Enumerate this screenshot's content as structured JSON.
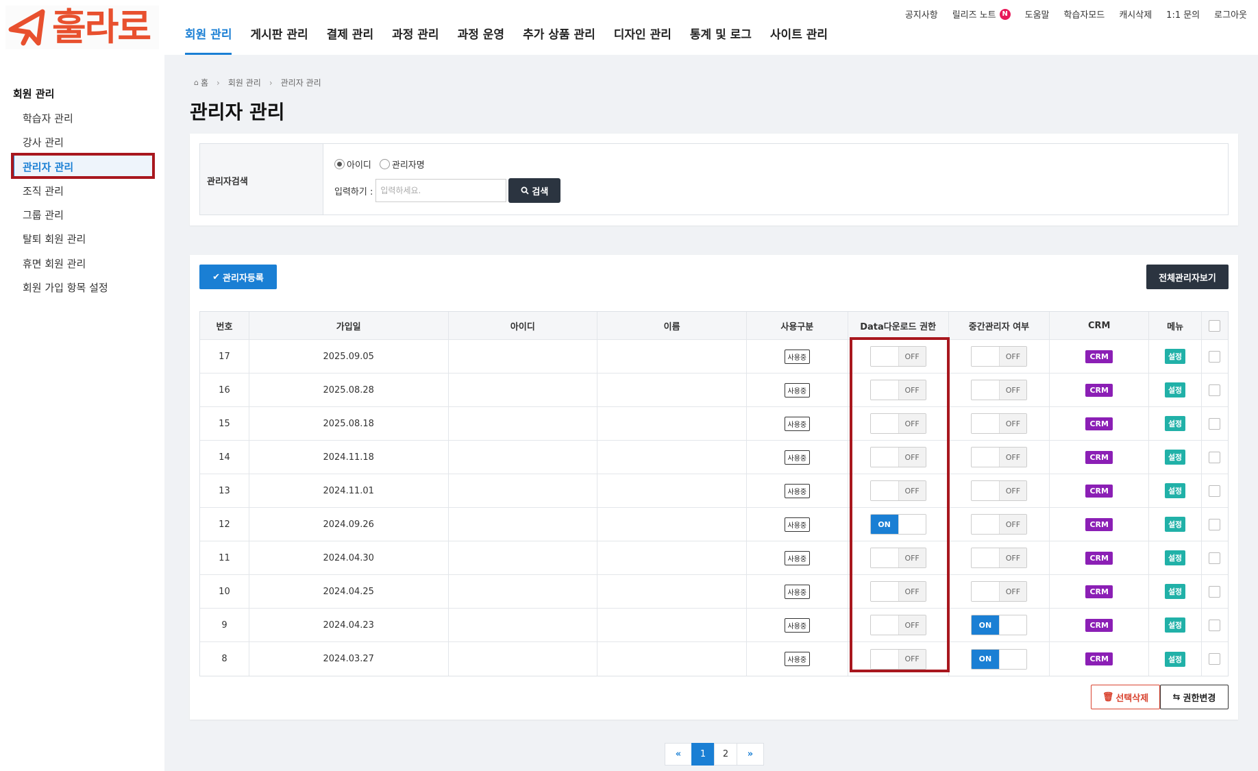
{
  "brand": {
    "logo_text": "훌라로",
    "accent_color": "#e8502e"
  },
  "gnb": [
    {
      "label": "회원 관리",
      "active": true
    },
    {
      "label": "게시판 관리"
    },
    {
      "label": "결제 관리"
    },
    {
      "label": "과정 관리"
    },
    {
      "label": "과정 운영"
    },
    {
      "label": "추가 상품 관리"
    },
    {
      "label": "디자인 관리"
    },
    {
      "label": "통계 및 로그"
    },
    {
      "label": "사이트 관리"
    }
  ],
  "util": {
    "notice": "공지사항",
    "release_notes": "릴리즈 노트",
    "new_badge": "N",
    "help": "도움말",
    "learner_mode": "학습자모드",
    "cache_delete": "캐시삭제",
    "inquiry": "1:1 문의",
    "logout": "로그아웃"
  },
  "sidebar": {
    "title": "회원 관리",
    "items": [
      {
        "label": "학습자 관리"
      },
      {
        "label": "강사 관리"
      },
      {
        "label": "관리자 관리",
        "active": true
      },
      {
        "label": "조직 관리"
      },
      {
        "label": "그룹 관리"
      },
      {
        "label": "탈퇴 회원 관리"
      },
      {
        "label": "휴면 회원 관리"
      },
      {
        "label": "회원 가입 항목 설정"
      }
    ]
  },
  "breadcrumb": {
    "home": "홈",
    "level1": "회원 관리",
    "level2": "관리자 관리"
  },
  "page_title": "관리자 관리",
  "search": {
    "label": "관리자검색",
    "radio_id": "아이디",
    "radio_name": "관리자명",
    "selected": "아이디",
    "input_label": "입력하기 :",
    "placeholder": "입력하세요.",
    "value": "",
    "button": "검색"
  },
  "actions": {
    "register": "관리자등록",
    "view_all": "전체관리자보기",
    "delete_selected": "선택삭제",
    "change_permission": "권한변경"
  },
  "table": {
    "headers": {
      "no": "번호",
      "join_date": "가입일",
      "user_id": "아이디",
      "name": "이름",
      "usage": "사용구분",
      "data_download": "Data다운로드 권한",
      "mid_admin": "중간관리자 여부",
      "crm": "CRM",
      "menu": "메뉴"
    },
    "rows": [
      {
        "no": "17",
        "date": "2025.09.05",
        "id": "",
        "name": "",
        "usage": "사용중",
        "dl": "OFF",
        "mid": "OFF",
        "crm": "CRM",
        "menu": "설정"
      },
      {
        "no": "16",
        "date": "2025.08.28",
        "id": "",
        "name": "",
        "usage": "사용중",
        "dl": "OFF",
        "mid": "OFF",
        "crm": "CRM",
        "menu": "설정"
      },
      {
        "no": "15",
        "date": "2025.08.18",
        "id": "",
        "name": "",
        "usage": "사용중",
        "dl": "OFF",
        "mid": "OFF",
        "crm": "CRM",
        "menu": "설정"
      },
      {
        "no": "14",
        "date": "2024.11.18",
        "id": "",
        "name": "",
        "usage": "사용중",
        "dl": "OFF",
        "mid": "OFF",
        "crm": "CRM",
        "menu": "설정"
      },
      {
        "no": "13",
        "date": "2024.11.01",
        "id": "",
        "name": "",
        "usage": "사용중",
        "dl": "OFF",
        "mid": "OFF",
        "crm": "CRM",
        "menu": "설정"
      },
      {
        "no": "12",
        "date": "2024.09.26",
        "id": "",
        "name": "",
        "usage": "사용중",
        "dl": "ON",
        "mid": "OFF",
        "crm": "CRM",
        "menu": "설정"
      },
      {
        "no": "11",
        "date": "2024.04.30",
        "id": "",
        "name": "",
        "usage": "사용중",
        "dl": "OFF",
        "mid": "OFF",
        "crm": "CRM",
        "menu": "설정"
      },
      {
        "no": "10",
        "date": "2024.04.25",
        "id": "",
        "name": "",
        "usage": "사용중",
        "dl": "OFF",
        "mid": "OFF",
        "crm": "CRM",
        "menu": "설정"
      },
      {
        "no": "9",
        "date": "2024.04.23",
        "id": "",
        "name": "",
        "usage": "사용중",
        "dl": "OFF",
        "mid": "ON",
        "crm": "CRM",
        "menu": "설정"
      },
      {
        "no": "8",
        "date": "2024.03.27",
        "id": "",
        "name": "",
        "usage": "사용중",
        "dl": "OFF",
        "mid": "ON",
        "crm": "CRM",
        "menu": "설정"
      }
    ]
  },
  "pagination": {
    "prev": "«",
    "pages": [
      "1",
      "2"
    ],
    "current": "1",
    "next": "»"
  },
  "colors": {
    "primary": "#1a7fd4",
    "dark_button": "#2b3440",
    "crm_badge": "#8b1fb5",
    "menu_badge": "#21b1a8",
    "highlight_box": "#a8171e",
    "delete_red": "#d9432f"
  },
  "icons": {
    "logo": "megaphone-logo-icon",
    "home": "home-icon",
    "search": "search-icon",
    "register": "check-icon",
    "delete": "trash-icon",
    "permission": "swap-arrows-icon"
  }
}
